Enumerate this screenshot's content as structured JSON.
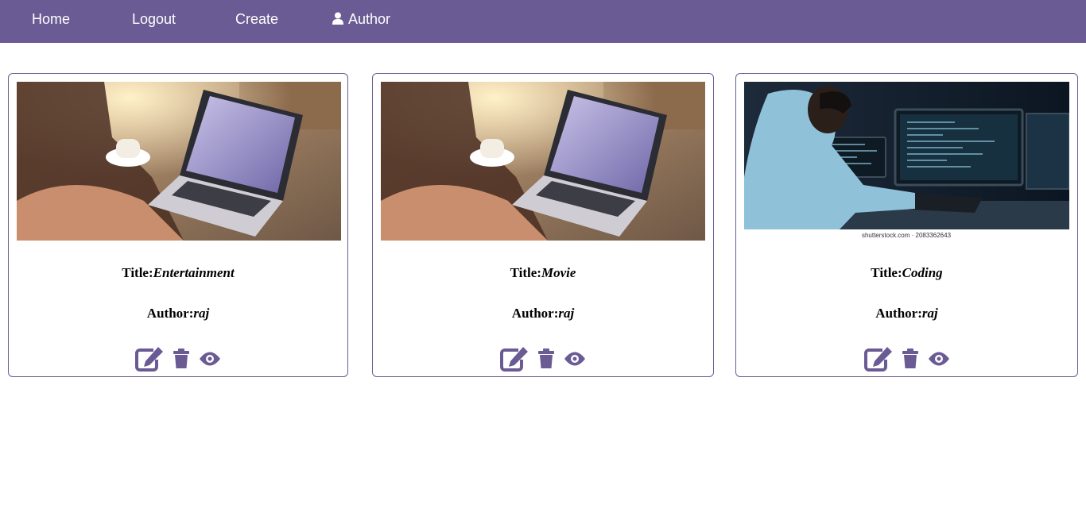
{
  "nav": {
    "home": "Home",
    "logout": "Logout",
    "create": "Create",
    "author": "Author",
    "user_icon": "user-icon"
  },
  "colors": {
    "primary": "#6b5b95",
    "card_border": "#6b5b95",
    "icon": "#6b5b95",
    "text": "#000000"
  },
  "cards": [
    {
      "title_label": "Title:",
      "title": "Entertainment",
      "author_label": "Author:",
      "author": "raj",
      "image": "laptop-cafe-photo"
    },
    {
      "title_label": "Title:",
      "title": "Movie",
      "author_label": "Author:",
      "author": "raj",
      "image": "laptop-cafe-photo"
    },
    {
      "title_label": "Title:",
      "title": "Coding",
      "author_label": "Author:",
      "author": "raj",
      "image": "programmer-monitors-photo",
      "image_caption": "shutterstock.com · 2083362643"
    }
  ],
  "actions": [
    "edit-icon",
    "trash-icon",
    "eye-icon"
  ]
}
